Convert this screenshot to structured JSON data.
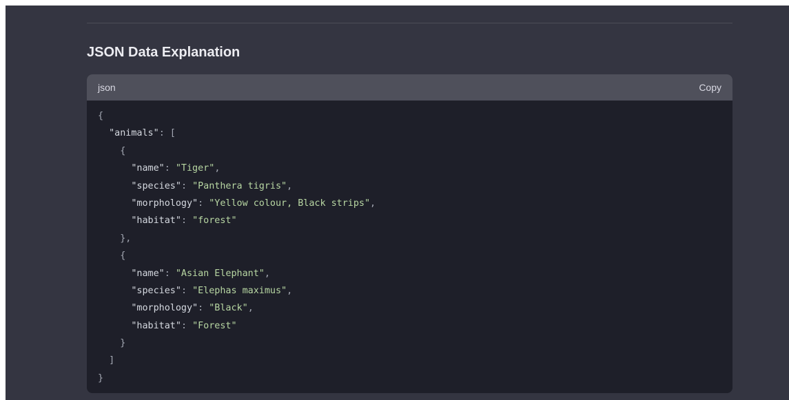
{
  "section": {
    "heading": "JSON Data Explanation"
  },
  "code_block": {
    "language": "json",
    "copy_label": "Copy",
    "lines": [
      [
        {
          "t": "punct",
          "v": "{"
        }
      ],
      [
        {
          "t": "ws",
          "v": "  "
        },
        {
          "t": "key",
          "v": "\"animals\""
        },
        {
          "t": "punct",
          "v": ": ["
        }
      ],
      [
        {
          "t": "ws",
          "v": "    "
        },
        {
          "t": "punct",
          "v": "{"
        }
      ],
      [
        {
          "t": "ws",
          "v": "      "
        },
        {
          "t": "key",
          "v": "\"name\""
        },
        {
          "t": "punct",
          "v": ": "
        },
        {
          "t": "str",
          "v": "\"Tiger\""
        },
        {
          "t": "punct",
          "v": ","
        }
      ],
      [
        {
          "t": "ws",
          "v": "      "
        },
        {
          "t": "key",
          "v": "\"species\""
        },
        {
          "t": "punct",
          "v": ": "
        },
        {
          "t": "str",
          "v": "\"Panthera tigris\""
        },
        {
          "t": "punct",
          "v": ","
        }
      ],
      [
        {
          "t": "ws",
          "v": "      "
        },
        {
          "t": "key",
          "v": "\"morphology\""
        },
        {
          "t": "punct",
          "v": ": "
        },
        {
          "t": "str",
          "v": "\"Yellow colour, Black strips\""
        },
        {
          "t": "punct",
          "v": ","
        }
      ],
      [
        {
          "t": "ws",
          "v": "      "
        },
        {
          "t": "key",
          "v": "\"habitat\""
        },
        {
          "t": "punct",
          "v": ": "
        },
        {
          "t": "str",
          "v": "\"forest\""
        }
      ],
      [
        {
          "t": "ws",
          "v": "    "
        },
        {
          "t": "punct",
          "v": "},"
        }
      ],
      [
        {
          "t": "ws",
          "v": "    "
        },
        {
          "t": "punct",
          "v": "{"
        }
      ],
      [
        {
          "t": "ws",
          "v": "      "
        },
        {
          "t": "key",
          "v": "\"name\""
        },
        {
          "t": "punct",
          "v": ": "
        },
        {
          "t": "str",
          "v": "\"Asian Elephant\""
        },
        {
          "t": "punct",
          "v": ","
        }
      ],
      [
        {
          "t": "ws",
          "v": "      "
        },
        {
          "t": "key",
          "v": "\"species\""
        },
        {
          "t": "punct",
          "v": ": "
        },
        {
          "t": "str",
          "v": "\"Elephas maximus\""
        },
        {
          "t": "punct",
          "v": ","
        }
      ],
      [
        {
          "t": "ws",
          "v": "      "
        },
        {
          "t": "key",
          "v": "\"morphology\""
        },
        {
          "t": "punct",
          "v": ": "
        },
        {
          "t": "str",
          "v": "\"Black\""
        },
        {
          "t": "punct",
          "v": ","
        }
      ],
      [
        {
          "t": "ws",
          "v": "      "
        },
        {
          "t": "key",
          "v": "\"habitat\""
        },
        {
          "t": "punct",
          "v": ": "
        },
        {
          "t": "str",
          "v": "\"Forest\""
        }
      ],
      [
        {
          "t": "ws",
          "v": "    "
        },
        {
          "t": "punct",
          "v": "}"
        }
      ],
      [
        {
          "t": "ws",
          "v": "  "
        },
        {
          "t": "punct",
          "v": "]"
        }
      ],
      [
        {
          "t": "punct",
          "v": "}"
        }
      ]
    ]
  },
  "colors": {
    "page_background": "#343541",
    "code_background": "#1e1f29",
    "code_header_background": "#4f505b",
    "string_color": "#b8d7a3",
    "key_color": "#d5d9e0",
    "punctuation_color": "#a4a8b3"
  }
}
